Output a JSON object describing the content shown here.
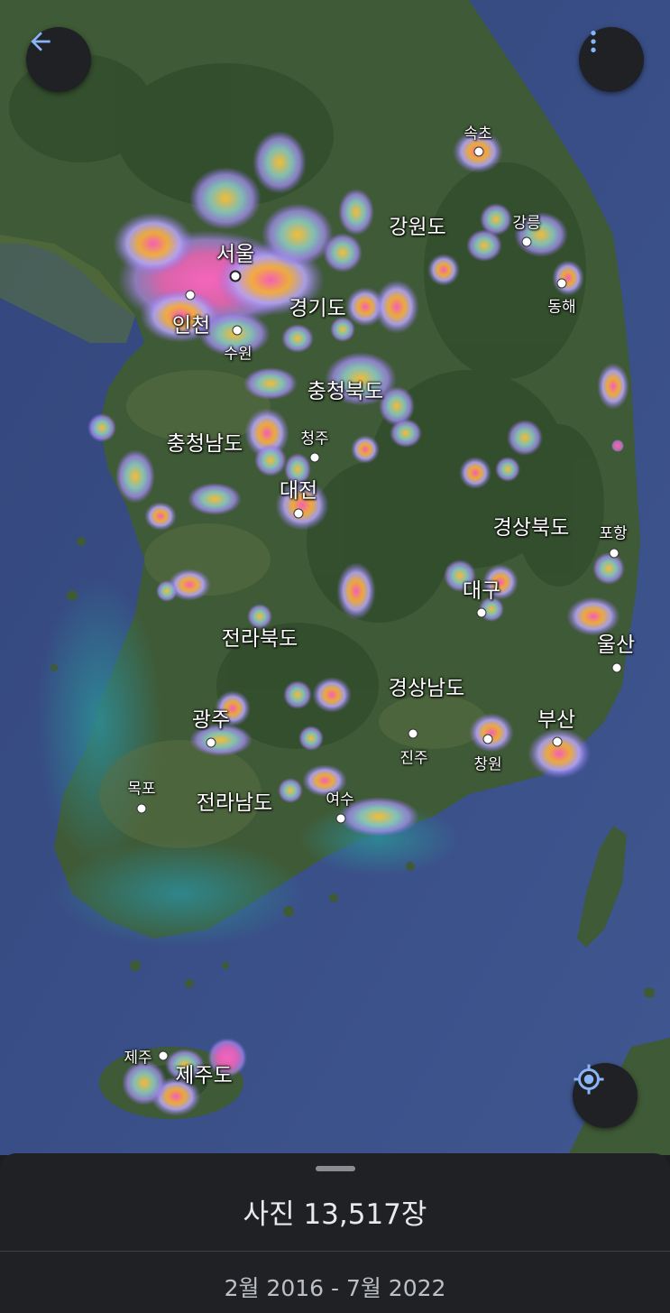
{
  "toolbar": {
    "back_icon": "arrow-back-icon",
    "menu_icon": "more-vert-icon",
    "locate_icon": "my-location-icon",
    "accent": "#8ab4f8"
  },
  "map": {
    "places": [
      {
        "id": "seoul",
        "label": "서울",
        "size": "big",
        "dot": "hollow"
      },
      {
        "id": "incheon",
        "label": "인천",
        "size": "big",
        "dot": "solid"
      },
      {
        "id": "suwon",
        "label": "수원",
        "size": "small",
        "dot": "solid"
      },
      {
        "id": "gyeonggi",
        "label": "경기도",
        "size": "big",
        "dot": "none"
      },
      {
        "id": "gangwon",
        "label": "강원도",
        "size": "big",
        "dot": "none"
      },
      {
        "id": "sokcho",
        "label": "속초",
        "size": "small",
        "dot": "solid"
      },
      {
        "id": "gangneung",
        "label": "강릉",
        "size": "small",
        "dot": "solid"
      },
      {
        "id": "donghae",
        "label": "동해",
        "size": "small",
        "dot": "solid"
      },
      {
        "id": "chungbuk",
        "label": "충청북도",
        "size": "big",
        "dot": "none"
      },
      {
        "id": "chungnam",
        "label": "충청남도",
        "size": "big",
        "dot": "none"
      },
      {
        "id": "cheongju",
        "label": "청주",
        "size": "small",
        "dot": "solid"
      },
      {
        "id": "daejeon",
        "label": "대전",
        "size": "big",
        "dot": "solid"
      },
      {
        "id": "gyeongbuk",
        "label": "경상북도",
        "size": "big",
        "dot": "none"
      },
      {
        "id": "pohang",
        "label": "포항",
        "size": "small",
        "dot": "solid"
      },
      {
        "id": "daegu",
        "label": "대구",
        "size": "big",
        "dot": "solid"
      },
      {
        "id": "ulsan",
        "label": "울산",
        "size": "big",
        "dot": "solid"
      },
      {
        "id": "jeonbuk",
        "label": "전라북도",
        "size": "big",
        "dot": "none"
      },
      {
        "id": "gyeongnam",
        "label": "경상남도",
        "size": "big",
        "dot": "none"
      },
      {
        "id": "gwangju",
        "label": "광주",
        "size": "big",
        "dot": "solid"
      },
      {
        "id": "busan",
        "label": "부산",
        "size": "big",
        "dot": "solid"
      },
      {
        "id": "jinju",
        "label": "진주",
        "size": "small",
        "dot": "solid"
      },
      {
        "id": "changwon",
        "label": "창원",
        "size": "small",
        "dot": "solid"
      },
      {
        "id": "mokpo",
        "label": "목포",
        "size": "small",
        "dot": "solid"
      },
      {
        "id": "jeonnam",
        "label": "전라남도",
        "size": "big",
        "dot": "none"
      },
      {
        "id": "yeosu",
        "label": "여수",
        "size": "small",
        "dot": "solid"
      },
      {
        "id": "jeju_city",
        "label": "제주",
        "size": "small",
        "dot": "solid"
      },
      {
        "id": "jejudo",
        "label": "제주도",
        "size": "big",
        "dot": "none"
      }
    ],
    "heatmap_colors": {
      "low": "#a58cf0",
      "mid": "#ffc233",
      "high": "#ff66c4",
      "water": "#3a4f86",
      "land": "#3f5a36"
    }
  },
  "sheet": {
    "photo_count": "사진 13,517장",
    "date_range": "2월 2016 - 7월 2022"
  }
}
